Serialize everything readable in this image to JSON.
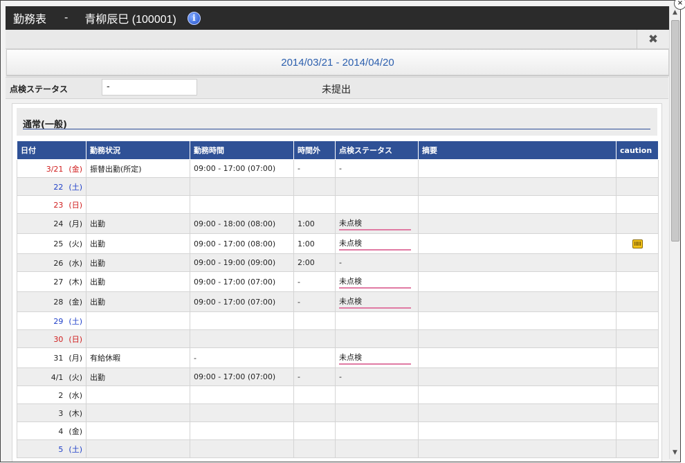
{
  "header": {
    "title": "勤務表",
    "separator": "-",
    "user": "青柳辰巳 (100001)",
    "info_icon": "info-icon"
  },
  "toolbar": {
    "close_icon": "✖"
  },
  "period": "2014/03/21 - 2014/04/20",
  "status": {
    "label": "点検ステータス",
    "value": "-",
    "text": "未提出"
  },
  "section_title": "通常(一般)",
  "columns": [
    "日付",
    "勤務状況",
    "勤務時間",
    "時間外",
    "点検ステータス",
    "摘要",
    "caution"
  ],
  "rows": [
    {
      "date": "3/21",
      "weekday": "(金)",
      "day_type": "sun",
      "status": "振替出勤(所定)",
      "time": "09:00 - 17:00 (07:00)",
      "overtime": "-",
      "check": "-",
      "check_mark": false,
      "summary": "",
      "caution": false
    },
    {
      "date": "22",
      "weekday": "(土)",
      "day_type": "sat",
      "status": "",
      "time": "",
      "overtime": "",
      "check": "",
      "check_mark": false,
      "summary": "",
      "caution": false
    },
    {
      "date": "23",
      "weekday": "(日)",
      "day_type": "sun",
      "status": "",
      "time": "",
      "overtime": "",
      "check": "",
      "check_mark": false,
      "summary": "",
      "caution": false
    },
    {
      "date": "24",
      "weekday": "(月)",
      "day_type": "",
      "status": "出勤",
      "time": "09:00 - 18:00 (08:00)",
      "overtime": "1:00",
      "check": "未点検",
      "check_mark": true,
      "summary": "",
      "caution": false
    },
    {
      "date": "25",
      "weekday": "(火)",
      "day_type": "",
      "status": "出勤",
      "time": "09:00 - 17:00 (08:00)",
      "overtime": "1:00",
      "check": "未点検",
      "check_mark": true,
      "summary": "",
      "caution": true
    },
    {
      "date": "26",
      "weekday": "(水)",
      "day_type": "",
      "status": "出勤",
      "time": "09:00 - 19:00 (09:00)",
      "overtime": "2:00",
      "check": "-",
      "check_mark": false,
      "summary": "",
      "caution": false
    },
    {
      "date": "27",
      "weekday": "(木)",
      "day_type": "",
      "status": "出勤",
      "time": "09:00 - 17:00 (07:00)",
      "overtime": "-",
      "check": "未点検",
      "check_mark": true,
      "summary": "",
      "caution": false
    },
    {
      "date": "28",
      "weekday": "(金)",
      "day_type": "",
      "status": "出勤",
      "time": "09:00 - 17:00 (07:00)",
      "overtime": "-",
      "check": "未点検",
      "check_mark": true,
      "summary": "",
      "caution": false
    },
    {
      "date": "29",
      "weekday": "(土)",
      "day_type": "sat",
      "status": "",
      "time": "",
      "overtime": "",
      "check": "",
      "check_mark": false,
      "summary": "",
      "caution": false
    },
    {
      "date": "30",
      "weekday": "(日)",
      "day_type": "sun",
      "status": "",
      "time": "",
      "overtime": "",
      "check": "",
      "check_mark": false,
      "summary": "",
      "caution": false
    },
    {
      "date": "31",
      "weekday": "(月)",
      "day_type": "",
      "status": "有給休暇",
      "time": "-",
      "overtime": "",
      "check": "未点検",
      "check_mark": true,
      "summary": "",
      "caution": false
    },
    {
      "date": "4/1",
      "weekday": "(火)",
      "day_type": "",
      "status": "出勤",
      "time": "09:00 - 17:00 (07:00)",
      "overtime": "-",
      "check": "-",
      "check_mark": false,
      "summary": "",
      "caution": false
    },
    {
      "date": "2",
      "weekday": "(水)",
      "day_type": "",
      "status": "",
      "time": "",
      "overtime": "",
      "check": "",
      "check_mark": false,
      "summary": "",
      "caution": false
    },
    {
      "date": "3",
      "weekday": "(木)",
      "day_type": "",
      "status": "",
      "time": "",
      "overtime": "",
      "check": "",
      "check_mark": false,
      "summary": "",
      "caution": false
    },
    {
      "date": "4",
      "weekday": "(金)",
      "day_type": "",
      "status": "",
      "time": "",
      "overtime": "",
      "check": "",
      "check_mark": false,
      "summary": "",
      "caution": false
    },
    {
      "date": "5",
      "weekday": "(土)",
      "day_type": "sat",
      "status": "",
      "time": "",
      "overtime": "",
      "check": "",
      "check_mark": false,
      "summary": "",
      "caution": false
    }
  ],
  "colors": {
    "header_bg": "#2f5196",
    "saturday": "#1e3fc8",
    "sunday": "#d01d1d",
    "period_text": "#2c5fae"
  }
}
